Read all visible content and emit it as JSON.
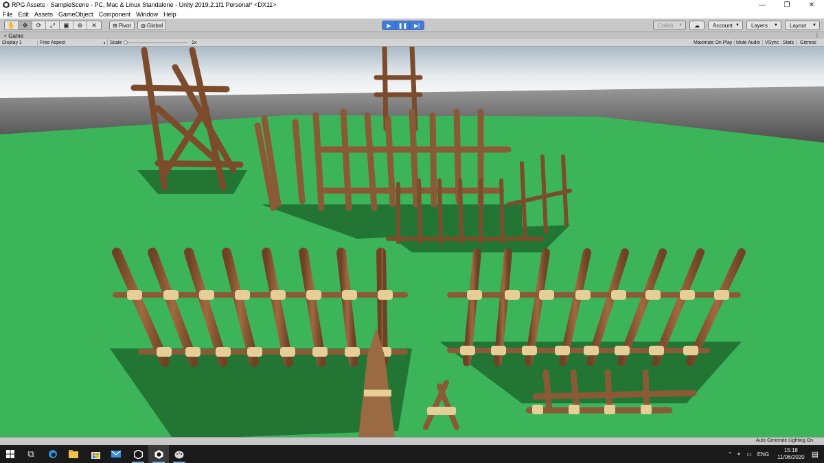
{
  "window": {
    "title": "RPG Assets - SampleScene - PC, Mac & Linux Standalone - Unity 2019.2.1f1 Personal* <DX11>"
  },
  "menu": [
    "File",
    "Edit",
    "Assets",
    "GameObject",
    "Component",
    "Window",
    "Help"
  ],
  "toolbar": {
    "tools": [
      "hand-icon",
      "move-icon",
      "rotate-icon",
      "scale-icon",
      "rect-icon",
      "transform-icon",
      "custom-tool-icon"
    ],
    "pivot_label": "Pivot",
    "global_label": "Global",
    "collab_label": "Collab",
    "account_label": "Account",
    "layers_label": "Layers",
    "layout_label": "Layout"
  },
  "game_tab": {
    "label": "Game"
  },
  "game_bar": {
    "display": "Display 1",
    "aspect": "Free Aspect",
    "scale_label": "Scale",
    "scale_value": "1x",
    "maximize_on_play": "Maximize On Play",
    "mute_audio": "Mute Audio",
    "vsync": "VSync",
    "stats": "Stats",
    "gizmos": "Gizmos"
  },
  "status": {
    "lighting": "Auto Generate Lighting On"
  },
  "taskbar": {
    "language": "ENG",
    "time": "15:18",
    "date": "11/06/2020"
  },
  "colors": {
    "ground": "#3cb55a",
    "sky_top": "#a9b9c6",
    "sky_bottom": "#fafafa",
    "horizon": "#545454",
    "wood": "#8a5a36",
    "rope": "#e6cf96",
    "accent_play": "#3d7be0"
  }
}
